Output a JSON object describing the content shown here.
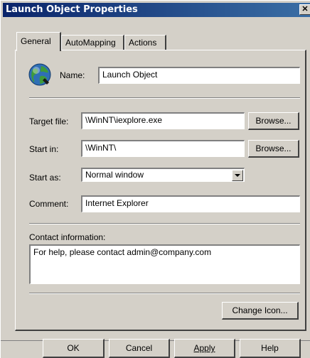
{
  "window": {
    "title": "Launch Object Properties",
    "close_label": "✕"
  },
  "tabs": [
    {
      "label": "General",
      "active": true
    },
    {
      "label": "AutoMapping",
      "active": false
    },
    {
      "label": "Actions",
      "active": false
    }
  ],
  "general": {
    "icon": "globe-icon",
    "name_label": "Name:",
    "name_value": "Launch Object",
    "target_label": "Target file:",
    "target_value": "\\WinNT\\iexplore.exe",
    "startin_label": "Start in:",
    "startin_value": "\\WinNT\\",
    "browse_label": "Browse...",
    "startas_label": "Start as:",
    "startas_value": "Normal window",
    "comment_label": "Comment:",
    "comment_value": "Internet Explorer",
    "contact_label": "Contact information:",
    "contact_value": "For help, please contact  admin@company.com",
    "change_icon_label": "Change Icon..."
  },
  "buttons": {
    "ok": "OK",
    "cancel": "Cancel",
    "apply": "Apply",
    "help": "Help"
  }
}
